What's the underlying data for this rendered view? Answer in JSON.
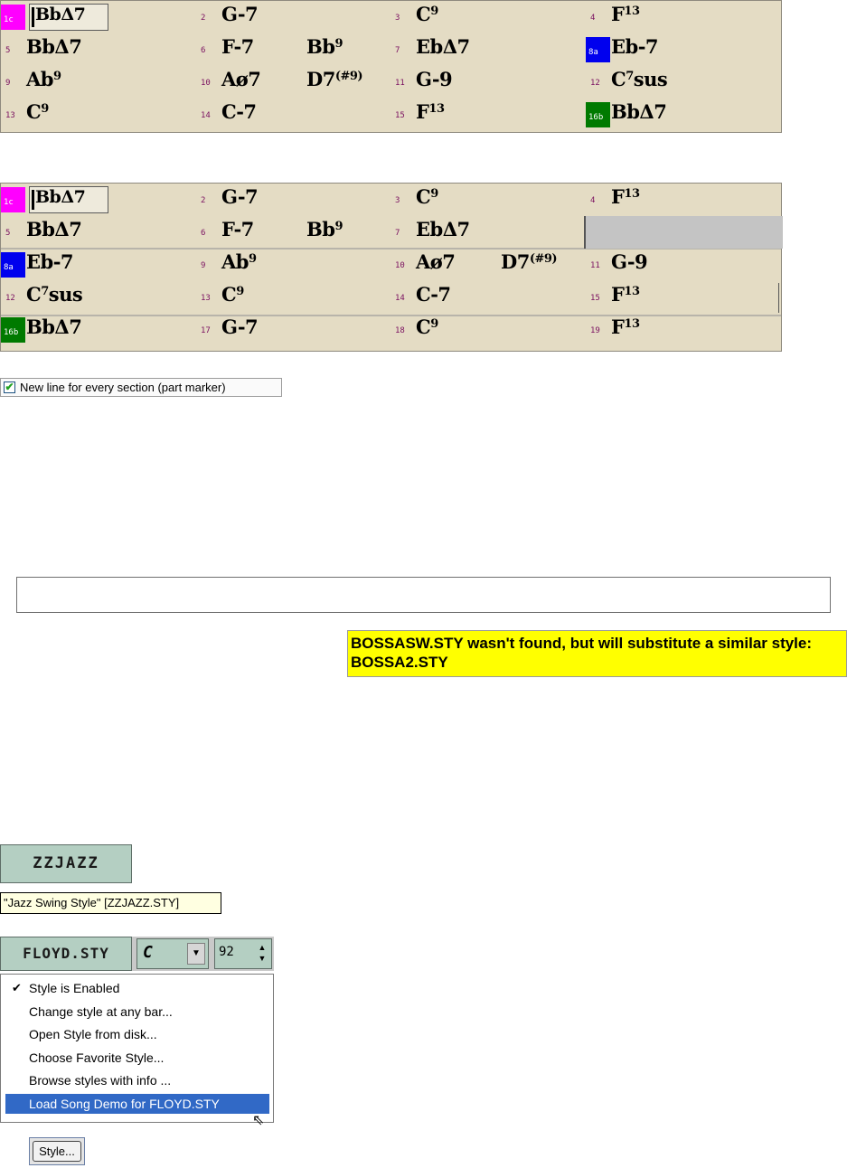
{
  "sheet1": {
    "rows": [
      [
        {
          "num": "",
          "marker": "1c",
          "marker_color": "#ff00ff",
          "chord1": "BbΔ7",
          "first": true
        },
        {
          "num": "2",
          "chord1": "G-7"
        },
        {
          "num": "3",
          "chord1": "C9"
        },
        {
          "num": "4",
          "chord1": "F13"
        }
      ],
      [
        {
          "num": "5",
          "chord1": "BbΔ7"
        },
        {
          "num": "6",
          "chord1": "F-7",
          "chord2": "Bb9"
        },
        {
          "num": "7",
          "chord1": "EbΔ7"
        },
        {
          "num": "",
          "marker": "8a",
          "marker_color": "#0000ee",
          "chord1": "Eb-7"
        }
      ],
      [
        {
          "num": "9",
          "chord1": "Ab9"
        },
        {
          "num": "10",
          "chord1": "Aø7",
          "chord2": "D7(#9)"
        },
        {
          "num": "11",
          "chord1": "G-9"
        },
        {
          "num": "12",
          "chord1": "C7sus"
        }
      ],
      [
        {
          "num": "13",
          "chord1": "C9"
        },
        {
          "num": "14",
          "chord1": "C-7"
        },
        {
          "num": "15",
          "chord1": "F13"
        },
        {
          "num": "",
          "marker": "16b",
          "marker_color": "#007a00",
          "chord1": "BbΔ7"
        }
      ]
    ]
  },
  "sheet2": {
    "rows": [
      [
        {
          "num": "",
          "marker": "1c",
          "marker_color": "#ff00ff",
          "chord1": "BbΔ7",
          "first": true
        },
        {
          "num": "2",
          "chord1": "G-7"
        },
        {
          "num": "3",
          "chord1": "C9"
        },
        {
          "num": "4",
          "chord1": "F13"
        }
      ],
      [
        {
          "num": "5",
          "chord1": "BbΔ7"
        },
        {
          "num": "6",
          "chord1": "F-7",
          "chord2": "Bb9"
        },
        {
          "num": "7",
          "chord1": "EbΔ7"
        }
      ],
      [
        {
          "num": "",
          "marker": "8a",
          "marker_color": "#0000ee",
          "chord1": "Eb-7"
        },
        {
          "num": "9",
          "chord1": "Ab9"
        },
        {
          "num": "10",
          "chord1": "Aø7",
          "chord2": "D7(#9)"
        },
        {
          "num": "11",
          "chord1": "G-9"
        }
      ],
      [
        {
          "num": "12",
          "chord1": "C7sus"
        },
        {
          "num": "13",
          "chord1": "C9"
        },
        {
          "num": "14",
          "chord1": "C-7"
        },
        {
          "num": "15",
          "chord1": "F13"
        }
      ],
      [
        {
          "num": "",
          "marker": "16b",
          "marker_color": "#007a00",
          "chord1": "BbΔ7"
        },
        {
          "num": "17",
          "chord1": "G-7"
        },
        {
          "num": "18",
          "chord1": "C9"
        },
        {
          "num": "19",
          "chord1": "F13"
        }
      ]
    ]
  },
  "newline_option": {
    "label": "New line for every section (part marker)",
    "checked": true
  },
  "notice": {
    "text": "BOSSASW.STY wasn't found, but will substitute a similar style: BOSSA2.STY"
  },
  "style_name_button": {
    "label": "ZZJAZZ"
  },
  "style_tooltip": {
    "text": "\"Jazz Swing Style\" [ZZJAZZ.STY]"
  },
  "toolbar": {
    "style_label": "FLOYD.STY",
    "key_value": "C",
    "tempo_value": "92"
  },
  "style_menu": {
    "items": [
      {
        "label": "Style is Enabled",
        "checked": true
      },
      {
        "label": "Change style at any bar..."
      },
      {
        "label": "Open Style from disk..."
      },
      {
        "label": "Choose Favorite Style..."
      },
      {
        "label": "Browse styles with info ..."
      },
      {
        "label": "Load Song Demo for FLOYD.STY",
        "highlighted": true
      }
    ]
  },
  "style_button": {
    "label": "Style..."
  },
  "icons": {
    "check": "checkmark-icon",
    "dropdown": "chevron-down-icon",
    "spin": "spin-arrows-icon",
    "cursor": "mouse-pointer-icon"
  }
}
